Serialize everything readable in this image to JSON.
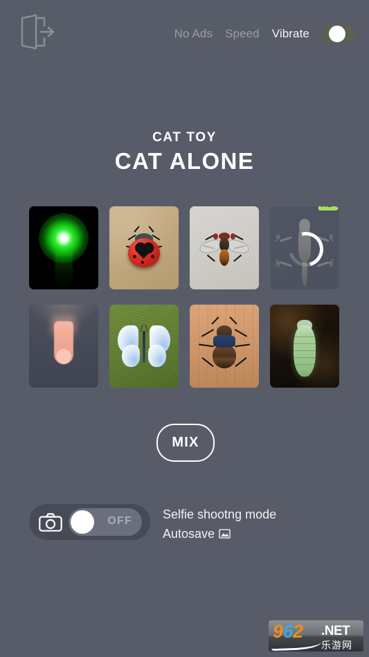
{
  "app": {
    "background_color": "#585c68",
    "subtitle": "CAT TOY",
    "title": "CAT ALONE"
  },
  "header": {
    "exit_icon": "exit-door-arrow-icon",
    "nav": [
      {
        "label": "No Ads",
        "active": false
      },
      {
        "label": "Speed",
        "active": false
      },
      {
        "label": "Vibrate",
        "active": true
      }
    ],
    "vibrate_toggle": {
      "state": "on",
      "track_color": "#5d6150",
      "knob_color": "#ffffff"
    }
  },
  "grid": {
    "tiles": [
      {
        "name": "laser-pointer",
        "label": "Green laser dot on black background"
      },
      {
        "name": "ladybug",
        "label": "Red ladybug with heart marking on cardboard"
      },
      {
        "name": "housefly",
        "label": "Housefly on light textured wall"
      },
      {
        "name": "lizard",
        "label": "Gecko lizard, locked",
        "locked": true,
        "loading": true,
        "ad_badge": "AD"
      },
      {
        "name": "finger-toy",
        "label": "Finger teaser on dark surface"
      },
      {
        "name": "butterfly",
        "label": "White blue butterfly on green grass"
      },
      {
        "name": "beetle",
        "label": "Beetle on wooden planks"
      },
      {
        "name": "caterpillar",
        "label": "Green caterpillar on dark soil"
      }
    ]
  },
  "mix": {
    "label": "MIX"
  },
  "selfie": {
    "camera_icon": "camera-icon",
    "toggle_state": "OFF",
    "line1": "Selfie shootng mode",
    "line2": "Autosave",
    "autosave_icon": "image-icon"
  },
  "watermark": {
    "digit1": "9",
    "digit2": "6",
    "digit3": "2",
    "tld": ".NET",
    "cn": "乐游网"
  }
}
